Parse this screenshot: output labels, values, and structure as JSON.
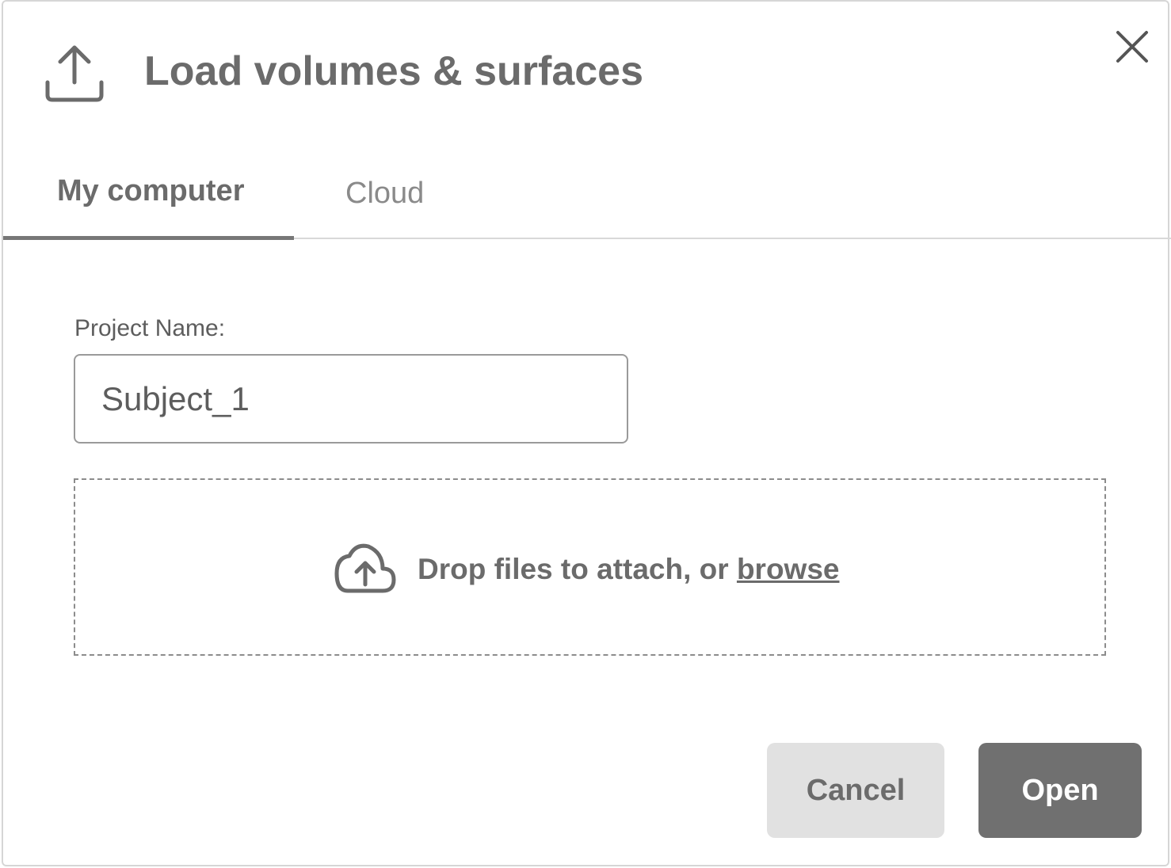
{
  "dialog": {
    "title": "Load volumes & surfaces",
    "header_icon": "upload-icon",
    "close_icon": "close-icon"
  },
  "tabs": [
    {
      "label": "My computer",
      "active": true
    },
    {
      "label": "Cloud",
      "active": false
    }
  ],
  "form": {
    "project_name_label": "Project Name:",
    "project_name_value": "Subject_1"
  },
  "dropzone": {
    "icon": "cloud-upload-icon",
    "text": "Drop files to attach, or ",
    "browse_label": "browse"
  },
  "actions": {
    "cancel_label": "Cancel",
    "open_label": "Open"
  },
  "colors": {
    "text": "#6b6b6b",
    "primary_button": "#707070",
    "secondary_button": "#e1e1e1"
  }
}
